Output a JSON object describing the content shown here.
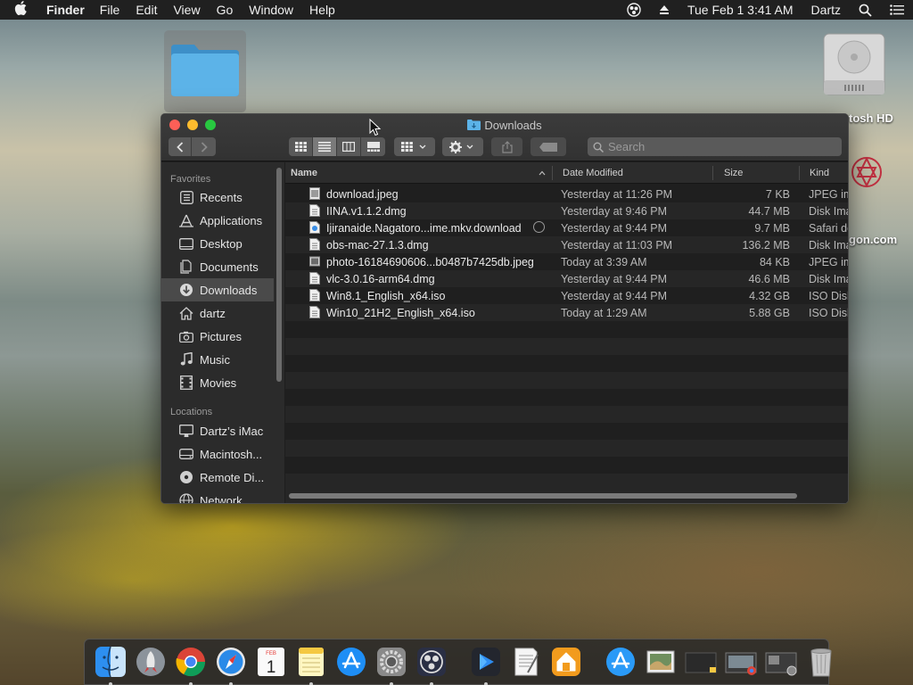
{
  "menubar": {
    "app_name": "Finder",
    "menus": [
      "File",
      "Edit",
      "View",
      "Go",
      "Window",
      "Help"
    ],
    "datetime": "Tue Feb 1  3:41 AM",
    "user": "Dartz"
  },
  "desktop": {
    "hd_label": "tosh HD",
    "right_label": "gon.com"
  },
  "window": {
    "title": "Downloads",
    "search_placeholder": "Search"
  },
  "sidebar": {
    "favorites_header": "Favorites",
    "favorites": [
      {
        "label": "Recents",
        "icon": "recents-icon"
      },
      {
        "label": "Applications",
        "icon": "applications-icon"
      },
      {
        "label": "Desktop",
        "icon": "desktop-icon"
      },
      {
        "label": "Documents",
        "icon": "documents-icon"
      },
      {
        "label": "Downloads",
        "icon": "downloads-icon",
        "selected": true
      },
      {
        "label": "dartz",
        "icon": "home-icon"
      },
      {
        "label": "Pictures",
        "icon": "pictures-icon"
      },
      {
        "label": "Music",
        "icon": "music-icon"
      },
      {
        "label": "Movies",
        "icon": "movies-icon"
      }
    ],
    "locations_header": "Locations",
    "locations": [
      {
        "label": "Dartz’s iMac",
        "icon": "imac-icon"
      },
      {
        "label": "Macintosh...",
        "icon": "disk-icon"
      },
      {
        "label": "Remote Di...",
        "icon": "remote-disc-icon"
      },
      {
        "label": "Network",
        "icon": "network-icon"
      }
    ]
  },
  "columns": {
    "name": "Name",
    "date": "Date Modified",
    "size": "Size",
    "kind": "Kind"
  },
  "files": [
    {
      "name": "download.jpeg",
      "date": "Yesterday at 11:26 PM",
      "size": "7 KB",
      "kind": "JPEG im"
    },
    {
      "name": "IINA.v1.1.2.dmg",
      "date": "Yesterday at 9:46 PM",
      "size": "44.7 MB",
      "kind": "Disk Ima"
    },
    {
      "name": "Ijiranaide.Nagatoro...ime.mkv.download",
      "date": "Yesterday at 9:44 PM",
      "size": "9.7 MB",
      "kind": "Safari do"
    },
    {
      "name": "obs-mac-27.1.3.dmg",
      "date": "Yesterday at 11:03 PM",
      "size": "136.2 MB",
      "kind": "Disk Ima"
    },
    {
      "name": "photo-16184690606...b0487b7425db.jpeg",
      "date": "Today at 3:39 AM",
      "size": "84 KB",
      "kind": "JPEG im"
    },
    {
      "name": "vlc-3.0.16-arm64.dmg",
      "date": "Yesterday at 9:44 PM",
      "size": "46.6 MB",
      "kind": "Disk Ima"
    },
    {
      "name": "Win8.1_English_x64.iso",
      "date": "Yesterday at 9:44 PM",
      "size": "4.32 GB",
      "kind": "ISO Disk"
    },
    {
      "name": "Win10_21H2_English_x64.iso",
      "date": "Today at 1:29 AM",
      "size": "5.88 GB",
      "kind": "ISO Disk"
    }
  ],
  "dock": [
    {
      "icon": "finder-icon",
      "running": true
    },
    {
      "icon": "launchpad-icon",
      "running": false
    },
    {
      "icon": "chrome-icon",
      "running": true
    },
    {
      "icon": "safari-icon",
      "running": true
    },
    {
      "icon": "calendar-icon",
      "running": false,
      "month": "FEB",
      "day": "1"
    },
    {
      "icon": "notes-icon",
      "running": true
    },
    {
      "icon": "app-store-icon",
      "running": false
    },
    {
      "icon": "system-preferences-icon",
      "running": true
    },
    {
      "icon": "obs-icon",
      "running": true
    },
    {
      "icon": "infuse-icon",
      "running": true
    },
    {
      "icon": "textedit-icon",
      "running": false
    },
    {
      "icon": "home-app-icon",
      "running": false
    },
    {
      "icon": "app-store-downloads-icon",
      "running": false
    },
    {
      "icon": "preview-icon",
      "running": false
    },
    {
      "icon": "window-thumb-1-icon",
      "running": false
    },
    {
      "icon": "window-thumb-2-icon",
      "running": false
    },
    {
      "icon": "window-thumb-3-icon",
      "running": false
    },
    {
      "icon": "trash-icon",
      "running": false
    }
  ]
}
